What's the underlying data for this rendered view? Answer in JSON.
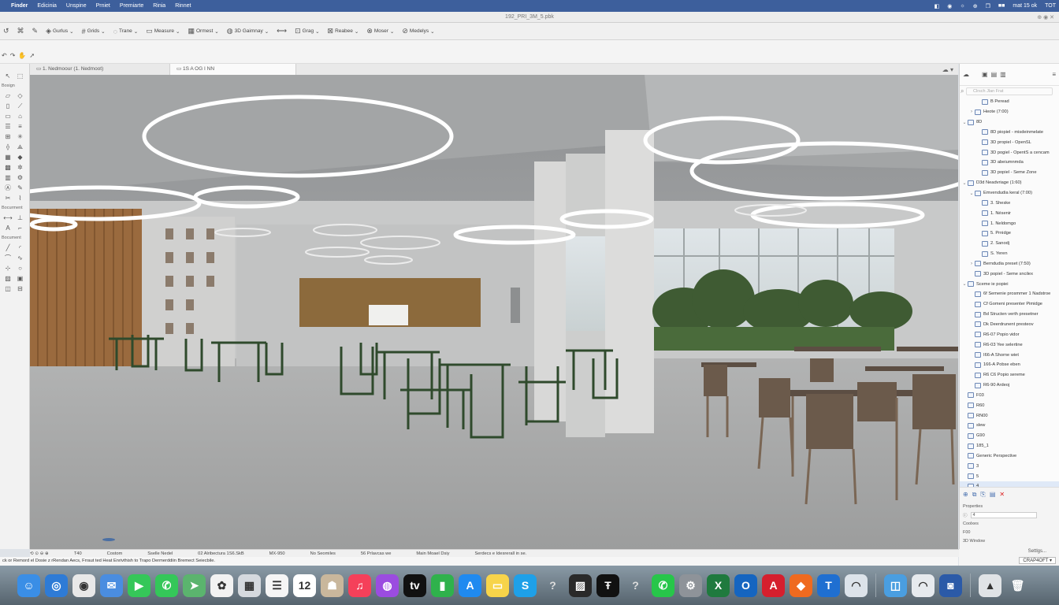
{
  "menubar": {
    "items": [
      "Finder",
      "Edicinia",
      "Unspine",
      "Prniet",
      "Premiarte",
      "Rinia",
      "Rinnet"
    ],
    "right": [
      "◧",
      "◉",
      "☼",
      "⊕",
      "❐",
      "■■",
      "mat 15 ok",
      "TOT"
    ]
  },
  "window": {
    "title": "192_PRI_3M_5.pbk",
    "right_text": "⊕ ◉ ✕"
  },
  "toolbar": {
    "items": [
      {
        "icon": "↺",
        "label": ""
      },
      {
        "icon": "⌘",
        "label": ""
      },
      {
        "icon": "✎",
        "label": ""
      },
      {
        "icon": "◈",
        "label": "Gurlus"
      },
      {
        "icon": "#",
        "label": "Grids"
      },
      {
        "icon": "◌",
        "label": "Trane"
      },
      {
        "icon": "▭",
        "label": "Measure"
      },
      {
        "icon": "▦",
        "label": "Ormest"
      },
      {
        "icon": "◍",
        "label": "3D Gaimnay"
      },
      {
        "icon": "⟷",
        "label": ""
      },
      {
        "icon": "⊡",
        "label": "Grag"
      },
      {
        "icon": "⊠",
        "label": "Reabee"
      },
      {
        "icon": "⊗",
        "label": "Moser"
      },
      {
        "icon": "⊘",
        "label": "Medelys"
      }
    ]
  },
  "tabs": [
    {
      "label": "1. Nedmoour (1. Nedmoot)",
      "active": false
    },
    {
      "label": "1S A OG I NN",
      "active": true
    }
  ],
  "left_sections": [
    "Bosign",
    "Bocurment",
    "Bocument"
  ],
  "navigator": {
    "search_placeholder": "Clrsch Jlan Frat",
    "tree": [
      {
        "label": "B Peread",
        "level": 2,
        "arrow": "",
        "icon": true
      },
      {
        "label": "Heote (7:00)",
        "level": 1,
        "arrow": "›",
        "icon": true
      },
      {
        "label": "8D",
        "level": 0,
        "arrow": "⌄",
        "icon": true
      },
      {
        "label": "8D piopiel - misdeinmelate",
        "level": 2,
        "arrow": "",
        "icon": true
      },
      {
        "label": "3D propiel - OpenSL",
        "level": 2,
        "arrow": "",
        "icon": true
      },
      {
        "label": "3D pogiel - OpentS a cencam",
        "level": 2,
        "arrow": "",
        "icon": true
      },
      {
        "label": "3D abeiumnmda",
        "level": 2,
        "arrow": "",
        "icon": true
      },
      {
        "label": "3D popiel - Seme Zone",
        "level": 2,
        "arrow": "",
        "icon": true
      },
      {
        "label": "D3d Neadvriage (1:60)",
        "level": 0,
        "arrow": "⌄",
        "icon": true
      },
      {
        "label": "Emvendudia keral (7:00)",
        "level": 1,
        "arrow": "⌄",
        "icon": true
      },
      {
        "label": "3. Sheske",
        "level": 2,
        "arrow": "",
        "icon": true
      },
      {
        "label": "1. Nésenir",
        "level": 2,
        "arrow": "",
        "icon": true
      },
      {
        "label": "1. Neldomgo",
        "level": 2,
        "arrow": "",
        "icon": true
      },
      {
        "label": "5. Prnidge",
        "level": 2,
        "arrow": "",
        "icon": true
      },
      {
        "label": "2. Sanodj",
        "level": 2,
        "arrow": "",
        "icon": true
      },
      {
        "label": "S. Yeren",
        "level": 2,
        "arrow": "",
        "icon": true
      },
      {
        "label": "Berndudia preset (7:50)",
        "level": 1,
        "arrow": "›",
        "icon": true
      },
      {
        "label": "3D popiel - Seme sncilex",
        "level": 1,
        "arrow": "",
        "icon": true
      },
      {
        "label": "Sceme ie popiei",
        "level": 0,
        "arrow": "⌄",
        "icon": true
      },
      {
        "label": "6f Semenie prosmmer 1 Nadstroe",
        "level": 1,
        "arrow": "",
        "icon": true
      },
      {
        "label": "Cf Gomeni presenter Pimidge",
        "level": 1,
        "arrow": "",
        "icon": true
      },
      {
        "label": "Bd Structen verth presetner",
        "level": 1,
        "arrow": "",
        "icon": true
      },
      {
        "label": "Dk Deerdrunent presteov",
        "level": 1,
        "arrow": "",
        "icon": true
      },
      {
        "label": "R6-07 Popio vidor",
        "level": 1,
        "arrow": "",
        "icon": true
      },
      {
        "label": "R6-03 Yee selertine",
        "level": 1,
        "arrow": "",
        "icon": true
      },
      {
        "label": "I66-A Shorne wiet",
        "level": 1,
        "arrow": "",
        "icon": true
      },
      {
        "label": "166-A Pobse eben",
        "level": 1,
        "arrow": "",
        "icon": true
      },
      {
        "label": "R6 C6 Popio sereme",
        "level": 1,
        "arrow": "",
        "icon": true
      },
      {
        "label": "R6-90 Ardeoj",
        "level": 1,
        "arrow": "",
        "icon": true
      },
      {
        "label": "F03",
        "level": 0,
        "arrow": "",
        "icon": true
      },
      {
        "label": "R60",
        "level": 0,
        "arrow": "",
        "icon": true
      },
      {
        "label": "RN00",
        "level": 0,
        "arrow": "",
        "icon": true
      },
      {
        "label": "slew",
        "level": 0,
        "arrow": "",
        "icon": true
      },
      {
        "label": "G90",
        "level": 0,
        "arrow": "",
        "icon": true
      },
      {
        "label": "185_1",
        "level": 0,
        "arrow": "",
        "icon": true
      },
      {
        "label": "Generic Perspective",
        "level": 0,
        "arrow": "",
        "icon": true
      },
      {
        "label": "3",
        "level": 0,
        "arrow": "",
        "icon": true
      },
      {
        "label": "5",
        "level": 0,
        "arrow": "",
        "icon": true
      },
      {
        "label": "4",
        "level": 0,
        "arrow": "",
        "icon": true,
        "selected": true
      }
    ],
    "bottom": {
      "title": "Properties",
      "value": "4",
      "rows": [
        "Coolxes",
        "F00",
        "3D Window"
      ]
    }
  },
  "statusbar": [
    "⟲ ⊙ ⊖ ⊕",
    "T40",
    "Costom",
    "Sselle Nedel",
    "02 Alribectura 1S6.SkB",
    "MX-950",
    "No Seomiles",
    "56 Prlavcas we",
    "Main Moael Dsiy",
    "Serdecs e Idesrerall in se."
  ],
  "hint": "ck or Remord el Dosie z rRendan Aecs, Frraut ted Heat Enrivthish to Trapo Dermerddiin Bremect Seiecbile.",
  "rightfooter": {
    "btn1": "Settlgs...",
    "btn2": "CRAP4OFT ▾"
  },
  "dock": [
    {
      "name": "finder",
      "color": "#3a8ee6",
      "glyph": "☺"
    },
    {
      "name": "safari",
      "color": "#2e7bd6",
      "glyph": "◎"
    },
    {
      "name": "chrome",
      "color": "#e8e8e8",
      "glyph": "◉"
    },
    {
      "name": "mail",
      "color": "#4a8de0",
      "glyph": "✉"
    },
    {
      "name": "facetime",
      "color": "#35c759",
      "glyph": "▶"
    },
    {
      "name": "messages",
      "color": "#34c759",
      "glyph": "✆"
    },
    {
      "name": "maps",
      "color": "#5bb46e",
      "glyph": "➤"
    },
    {
      "name": "photos",
      "color": "#f2f2f2",
      "glyph": "✿"
    },
    {
      "name": "launchpad",
      "color": "#d5d9de",
      "glyph": "▦"
    },
    {
      "name": "reminders",
      "color": "#f5f5f5",
      "glyph": "☰"
    },
    {
      "name": "calendar",
      "color": "#ffffff",
      "glyph": "12"
    },
    {
      "name": "contacts",
      "color": "#c9b79c",
      "glyph": "☗"
    },
    {
      "name": "music",
      "color": "#f5405a",
      "glyph": "♫"
    },
    {
      "name": "podcasts",
      "color": "#9b4ce0",
      "glyph": "◍"
    },
    {
      "name": "tv",
      "color": "#111111",
      "glyph": "tv"
    },
    {
      "name": "numbers",
      "color": "#2fb24c",
      "glyph": "▮"
    },
    {
      "name": "appstore",
      "color": "#1f8af0",
      "glyph": "A"
    },
    {
      "name": "notes",
      "color": "#f7d44a",
      "glyph": "▭"
    },
    {
      "name": "skype",
      "color": "#1ea0e8",
      "glyph": "S"
    },
    {
      "name": "help",
      "color": "transparent",
      "glyph": "?"
    },
    {
      "name": "pixelmator",
      "color": "#2a2a2a",
      "glyph": "▨"
    },
    {
      "name": "archicad",
      "color": "#111111",
      "glyph": "Ŧ"
    },
    {
      "name": "help2",
      "color": "transparent",
      "glyph": "?"
    },
    {
      "name": "whatsapp",
      "color": "#27c64a",
      "glyph": "✆"
    },
    {
      "name": "settings",
      "color": "#8e9399",
      "glyph": "⚙"
    },
    {
      "name": "excel",
      "color": "#1f7a3e",
      "glyph": "X"
    },
    {
      "name": "outlook",
      "color": "#1565c0",
      "glyph": "O"
    },
    {
      "name": "acrobat",
      "color": "#d51f2e",
      "glyph": "A"
    },
    {
      "name": "sketch",
      "color": "#ef6a1f",
      "glyph": "◆"
    },
    {
      "name": "twinmotion",
      "color": "#1f6fd1",
      "glyph": "T"
    },
    {
      "name": "curve",
      "color": "#dce3ea",
      "glyph": "◠"
    },
    {
      "name": "spacer",
      "color": "transparent",
      "glyph": ""
    },
    {
      "name": "finder2",
      "color": "#4a9ee0",
      "glyph": "◫"
    },
    {
      "name": "curve2",
      "color": "#e6eaee",
      "glyph": "◠"
    },
    {
      "name": "disk",
      "color": "#2b5aa8",
      "glyph": "◙"
    },
    {
      "name": "spacer2",
      "color": "transparent",
      "glyph": ""
    },
    {
      "name": "stack",
      "color": "#e0e3e6",
      "glyph": "▲"
    },
    {
      "name": "trash",
      "color": "transparent",
      "glyph": "🗑"
    }
  ]
}
